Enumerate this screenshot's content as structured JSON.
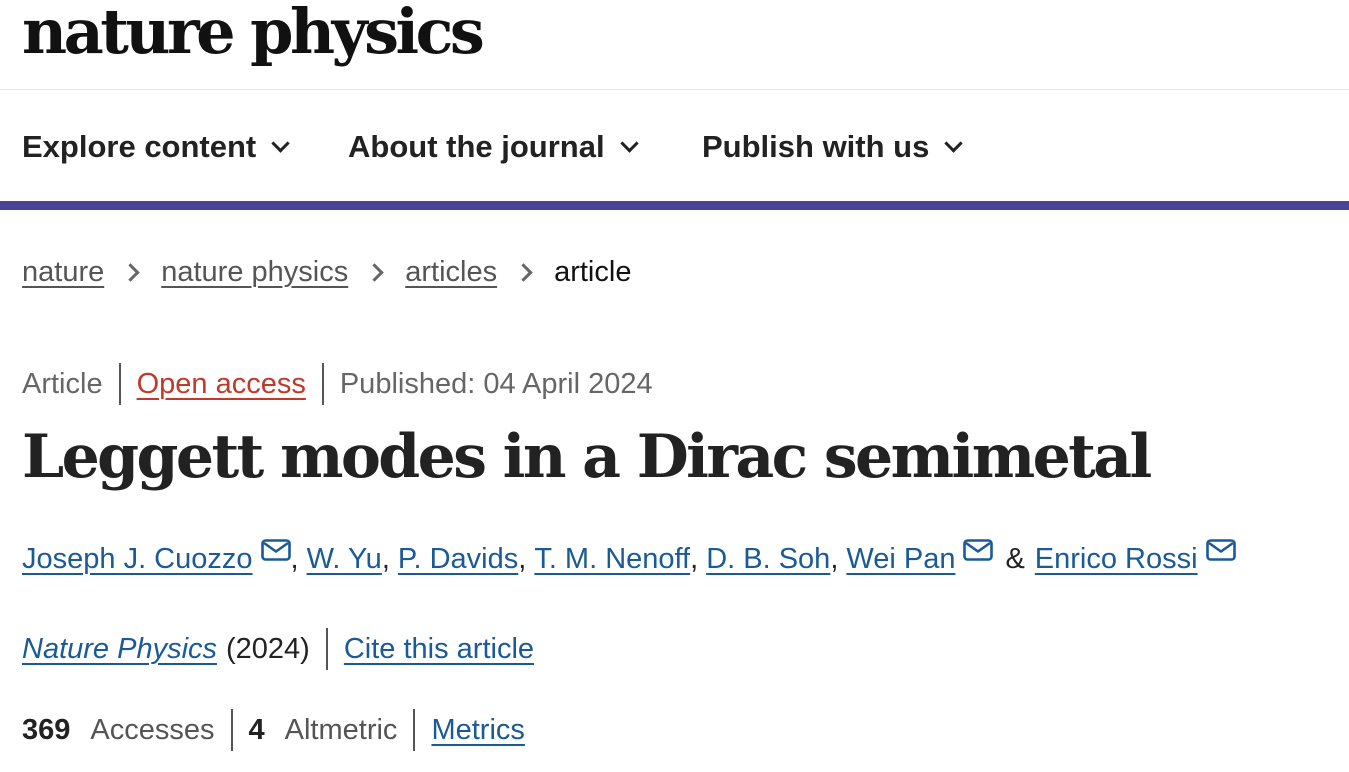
{
  "header": {
    "logo_text": "nature physics"
  },
  "nav": {
    "items": [
      {
        "label": "Explore content"
      },
      {
        "label": "About the journal"
      },
      {
        "label": "Publish with us"
      }
    ]
  },
  "breadcrumb": {
    "items": [
      "nature",
      "nature physics",
      "articles"
    ],
    "current": "article"
  },
  "article": {
    "type": "Article",
    "access": "Open access",
    "published": "Published: 04 April 2024",
    "title": "Leggett modes in a Dirac semimetal",
    "authors": [
      {
        "name": "Joseph J. Cuozzo",
        "has_email": true
      },
      {
        "name": "W. Yu",
        "has_email": false
      },
      {
        "name": "P. Davids",
        "has_email": false
      },
      {
        "name": "T. M. Nenoff",
        "has_email": false
      },
      {
        "name": "D. B. Soh",
        "has_email": false
      },
      {
        "name": "Wei Pan",
        "has_email": true
      },
      {
        "name": "Enrico Rossi",
        "has_email": true
      }
    ],
    "author_separator": ",",
    "author_last_joiner": "&",
    "journal": "Nature Physics",
    "year": "(2024)",
    "cite_label": "Cite this article"
  },
  "metrics": {
    "accesses_count": "369",
    "accesses_label": "Accesses",
    "altmetric_count": "4",
    "altmetric_label": "Altmetric",
    "metrics_link": "Metrics"
  },
  "colors": {
    "accent_rule": "#4a4496",
    "link_blue": "#1a5a96",
    "open_access": "#c0392b"
  },
  "icons": {
    "nav_dropdown": "chevron-down-icon",
    "breadcrumb_separator": "chevron-right-icon",
    "author_email": "envelope-icon"
  }
}
